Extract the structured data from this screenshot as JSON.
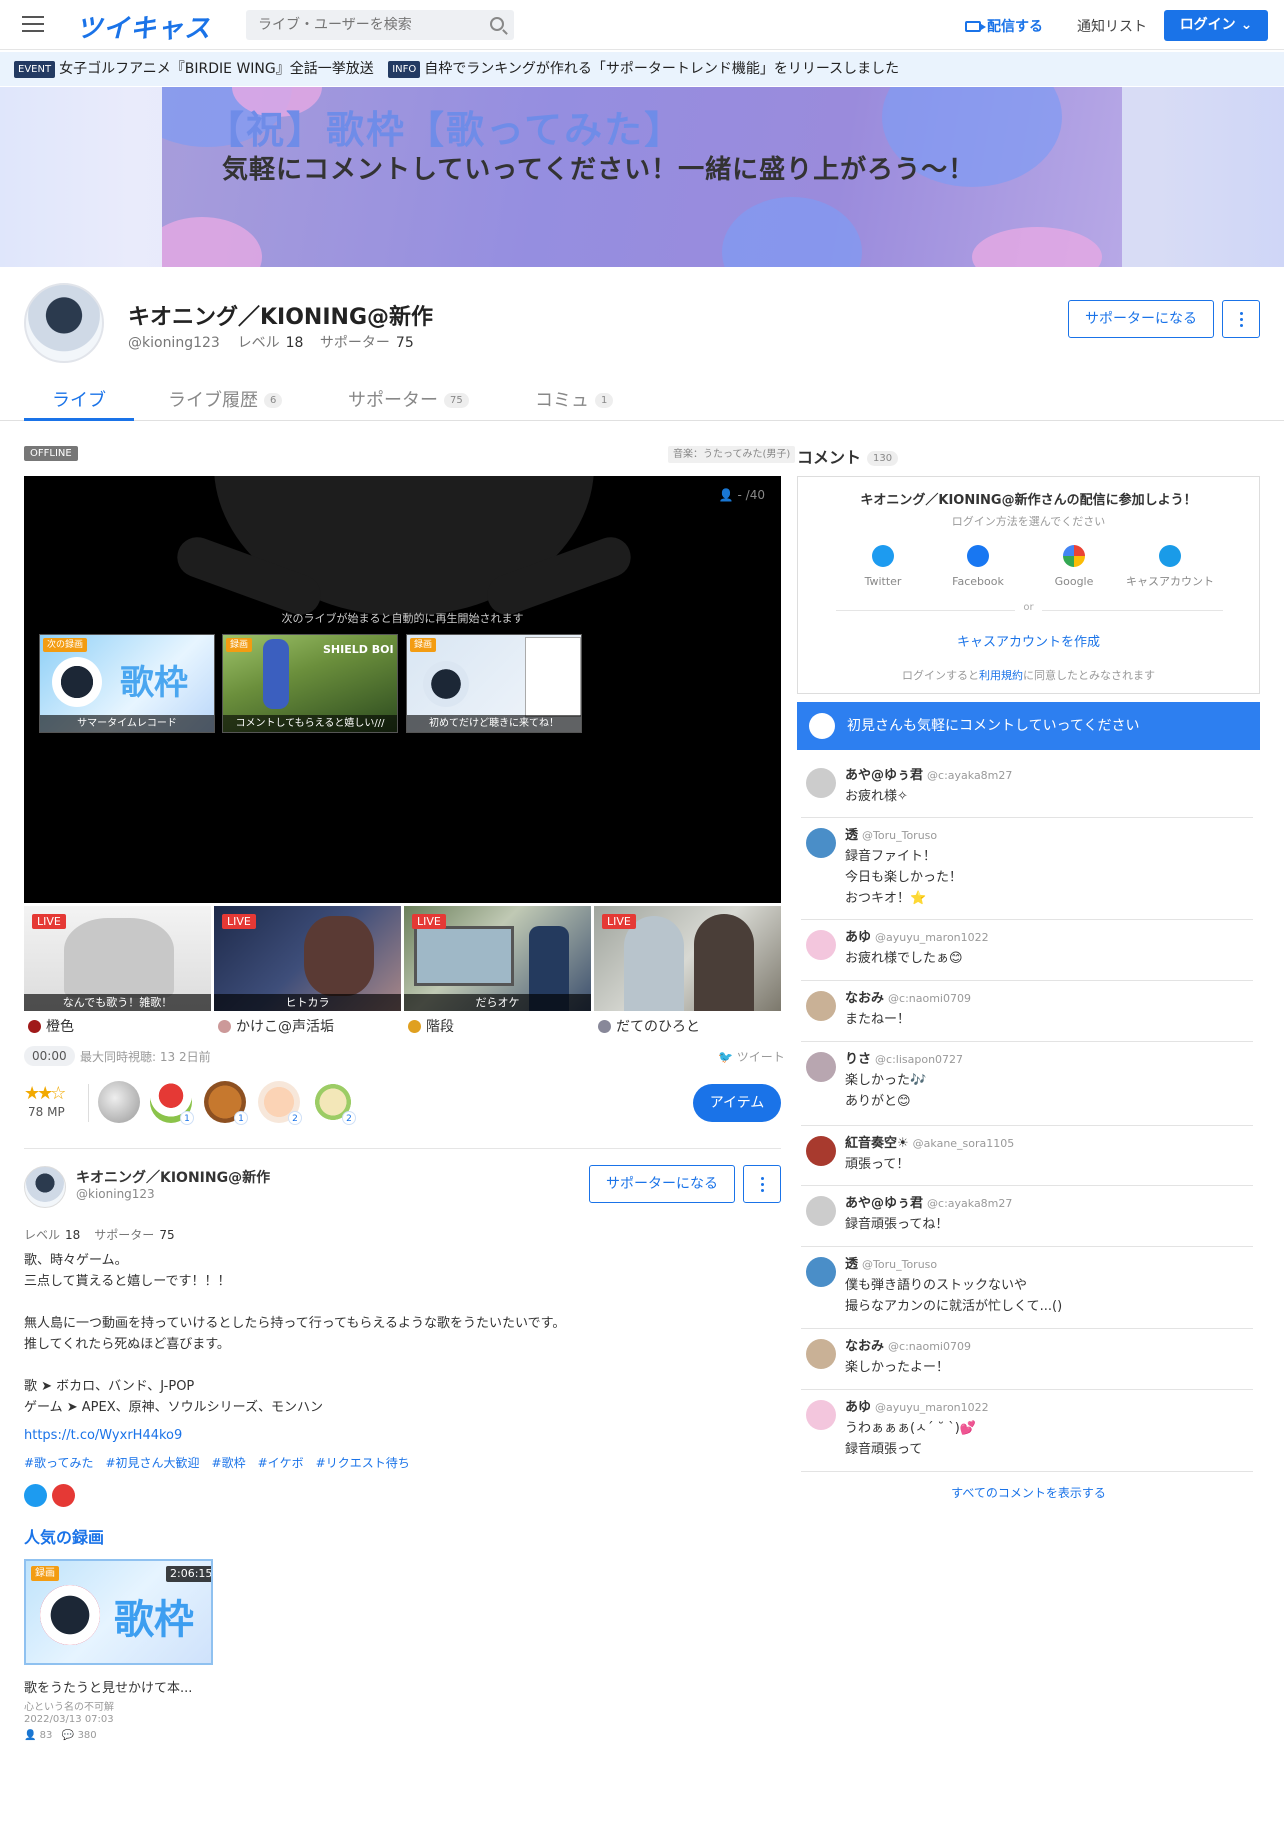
{
  "header": {
    "logo": "ツイキャス",
    "search_placeholder": "ライブ・ユーザーを検索",
    "broadcast": "配信する",
    "notify": "通知リスト",
    "login": "ログイン"
  },
  "infobar": {
    "event_tag": "EVENT",
    "event_text": "女子ゴルフアニメ『BIRDIE WING』全話一挙放送",
    "info_tag": "INFO",
    "info_text": "自枠でランキングが作れる「サポータートレンド機能」をリリースしました"
  },
  "banner": {
    "title": "【祝】歌枠【歌ってみた】",
    "subtitle": "気軽にコメントしていってください！一緒に盛り上がろう～！"
  },
  "profile": {
    "name": "キオニング／KIONING@新作",
    "id": "@kioning123",
    "level_label": "レベル",
    "level": "18",
    "supporter_label": "サポーター",
    "supporters": "75",
    "support_button": "サポーターになる"
  },
  "tabs": [
    {
      "label": "ライブ",
      "count": ""
    },
    {
      "label": "ライブ履歴",
      "count": "6"
    },
    {
      "label": "サポーター",
      "count": "75"
    },
    {
      "label": "コミュ",
      "count": "1"
    }
  ],
  "player": {
    "status": "OFFLINE",
    "genre": "音楽：うたってみた(男子)",
    "viewers": "- /40",
    "next_message": "次のライブが始まると自動的に再生開始されます",
    "next": [
      {
        "badge": "次の録画",
        "label": "サマータイムレコード"
      },
      {
        "badge": "録画",
        "label": "コメントしてもらえると嬉しい///"
      },
      {
        "badge": "録画",
        "label": "初めてだけど聴きに来てね！"
      }
    ]
  },
  "lives": [
    {
      "badge": "LIVE",
      "caption": "なんでも歌う！雑歌！",
      "name": "橙色"
    },
    {
      "badge": "LIVE",
      "caption": "ヒトカラ",
      "name": "かけこ@声活垢"
    },
    {
      "badge": "LIVE",
      "caption": "だらオケ",
      "name": "階段"
    },
    {
      "badge": "LIVE",
      "caption": "",
      "name": "だてのひろと"
    }
  ],
  "stats": {
    "time": "00:00",
    "meta": "最大同時視聴: 13  2日前",
    "tweet": "ツイート"
  },
  "items": {
    "mp": "78 MP",
    "counts": [
      "",
      "1",
      "1",
      "2",
      "2"
    ],
    "button": "アイテム"
  },
  "about": {
    "bio": "歌、時々ゲーム。\n三点して貰えると嬉しーです！！！\n\n無人島に一つ動画を持っていけるとしたら持って行ってもらえるような歌をうたいたいです。\n推してくれたら死ぬほど喜びます。\n\n歌 ➤ ボカロ、バンド、J-POP\nゲーム ➤ APEX、原神、ソウルシリーズ、モンハン",
    "link": "https://t.co/WyxrH44ko9",
    "tags": [
      "#歌ってみた",
      "#初見さん大歓迎",
      "#歌枠",
      "#イケボ",
      "#リクエスト待ち"
    ]
  },
  "popular": {
    "heading": "人気の録画",
    "badge": "録画",
    "duration": "2:06:15",
    "title": "歌をうたうと見せかけて本...",
    "owner": "心という名の不可解",
    "date": "2022/03/13 07:03",
    "views": "83",
    "comments": "380"
  },
  "comments_panel": {
    "heading": "コメント",
    "count": "130",
    "login_title": "キオニング／KIONING@新作さんの配信に参加しよう！",
    "login_sub": "ログイン方法を選んでください",
    "providers": [
      "Twitter",
      "Facebook",
      "Google",
      "キャスアカウント"
    ],
    "or": "or",
    "create": "キャスアカウントを作成",
    "terms_pre": "ログインすると",
    "terms_link": "利用規約",
    "terms_post": "に同意したとみなされます",
    "welcome": "初見さんも気軽にコメントしていってください",
    "all": "すべてのコメントを表示する"
  },
  "comments": [
    {
      "name": "あや@ゆぅ君",
      "id": "@c:ayaka8m27",
      "text": "お疲れ様✧"
    },
    {
      "name": "透",
      "id": "@Toru_Toruso",
      "text": "録音ファイト！\n今日も楽しかった！\nおつキオ！⭐"
    },
    {
      "name": "あゆ",
      "id": "@ayuyu_maron1022",
      "text": "お疲れ様でしたぁ😊"
    },
    {
      "name": "なおみ",
      "id": "@c:naomi0709",
      "text": "またねー！"
    },
    {
      "name": "りさ",
      "id": "@c:lisapon0727",
      "text": "楽しかった🎶\nありがと😊"
    },
    {
      "name": "紅音奏空☀",
      "id": "@akane_sora1105",
      "text": "頑張って！"
    },
    {
      "name": "あや@ゆぅ君",
      "id": "@c:ayaka8m27",
      "text": "録音頑張ってね！"
    },
    {
      "name": "透",
      "id": "@Toru_Toruso",
      "text": "僕も弾き語りのストックないや\n撮らなアカンのに就活が忙しくて...()"
    },
    {
      "name": "なおみ",
      "id": "@c:naomi0709",
      "text": "楽しかったよー！"
    },
    {
      "name": "あゆ",
      "id": "@ayuyu_maron1022",
      "text": "うわぁぁぁ(ㅅ´ ˘ `)💕\n録音頑張って"
    }
  ]
}
